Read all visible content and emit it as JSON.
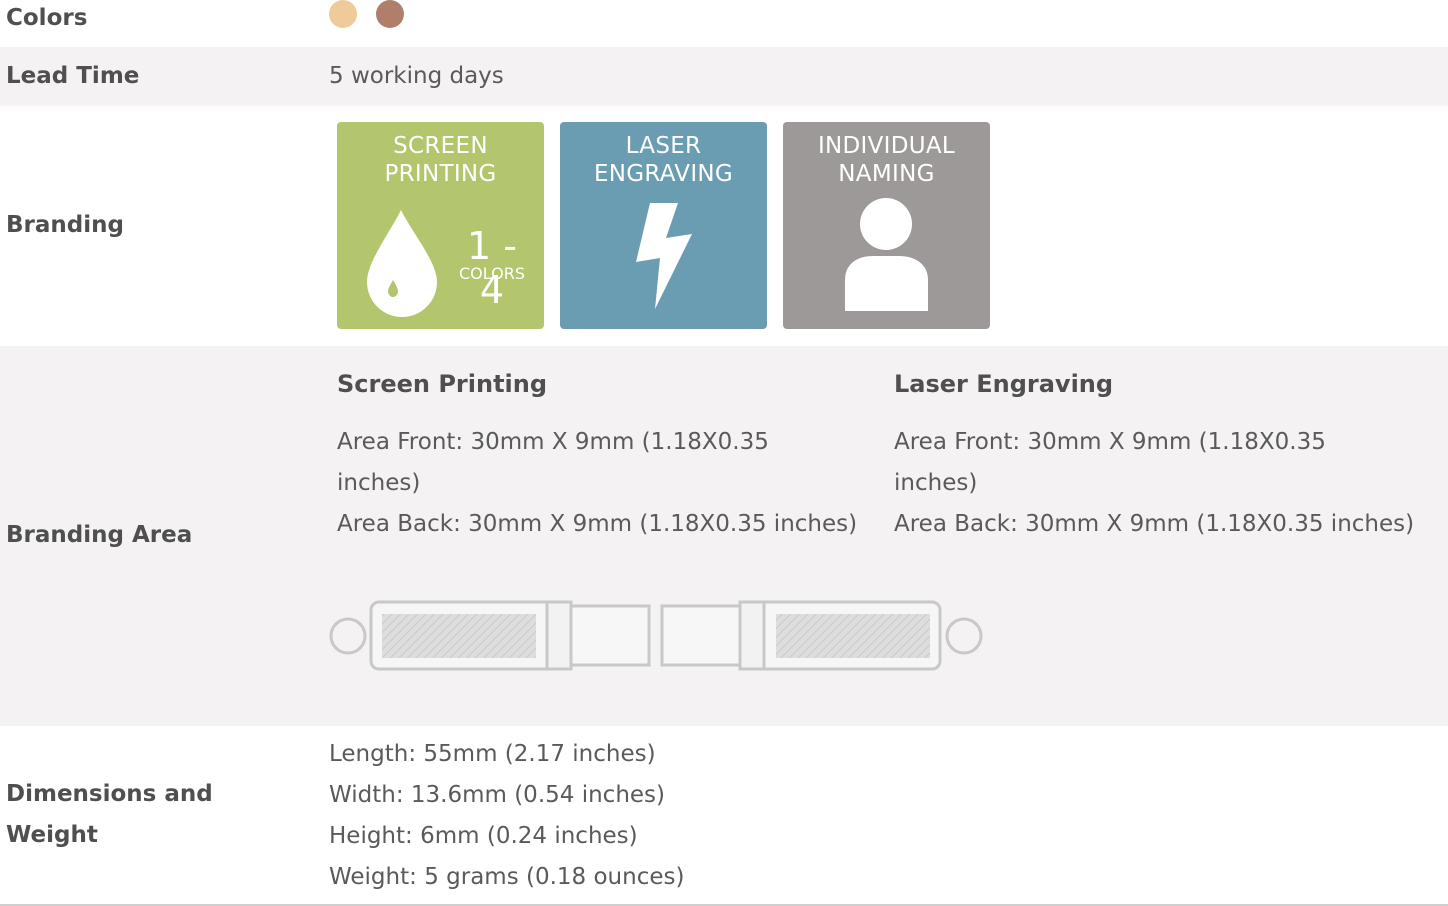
{
  "rows": {
    "colors": {
      "label": "Colors",
      "swatches": [
        {
          "name": "gold",
          "color": "#eecb98"
        },
        {
          "name": "bronze",
          "color": "#b07f6b"
        }
      ]
    },
    "lead_time": {
      "label": "Lead Time",
      "value": "5 working days"
    },
    "branding": {
      "label": "Branding",
      "tiles": [
        {
          "line1": "SCREEN",
          "line2": "PRINTING",
          "badge_range": "1 - 4",
          "badge_unit": "COLORS",
          "color": "#b3c56d"
        },
        {
          "line1": "LASER",
          "line2": "ENGRAVING",
          "color": "#6a9db2"
        },
        {
          "line1": "INDIVIDUAL",
          "line2": "NAMING",
          "color": "#9c9998"
        }
      ]
    },
    "branding_area": {
      "label": "Branding Area",
      "columns": [
        {
          "heading": "Screen Printing",
          "front_line1": "Area Front: 30mm X 9mm (1.18X0.35",
          "front_line2": "inches)",
          "back": "Area Back: 30mm X 9mm (1.18X0.35 inches)"
        },
        {
          "heading": "Laser Engraving",
          "front_line1": "Area Front: 30mm X 9mm (1.18X0.35",
          "front_line2": "inches)",
          "back": "Area Back: 30mm X 9mm (1.18X0.35 inches)"
        }
      ]
    },
    "dimensions": {
      "label_line1": "Dimensions and",
      "label_line2": "Weight",
      "lines": [
        "Length: 55mm (2.17 inches)",
        "Width: 13.6mm (0.54 inches)",
        "Height: 6mm (0.24 inches)",
        "Weight: 5 grams (0.18 ounces)"
      ]
    }
  },
  "theme": {
    "row_alt_bg": "#f4f2f3",
    "label_color": "#4f4f4f",
    "text_color": "#5a5a5a"
  }
}
